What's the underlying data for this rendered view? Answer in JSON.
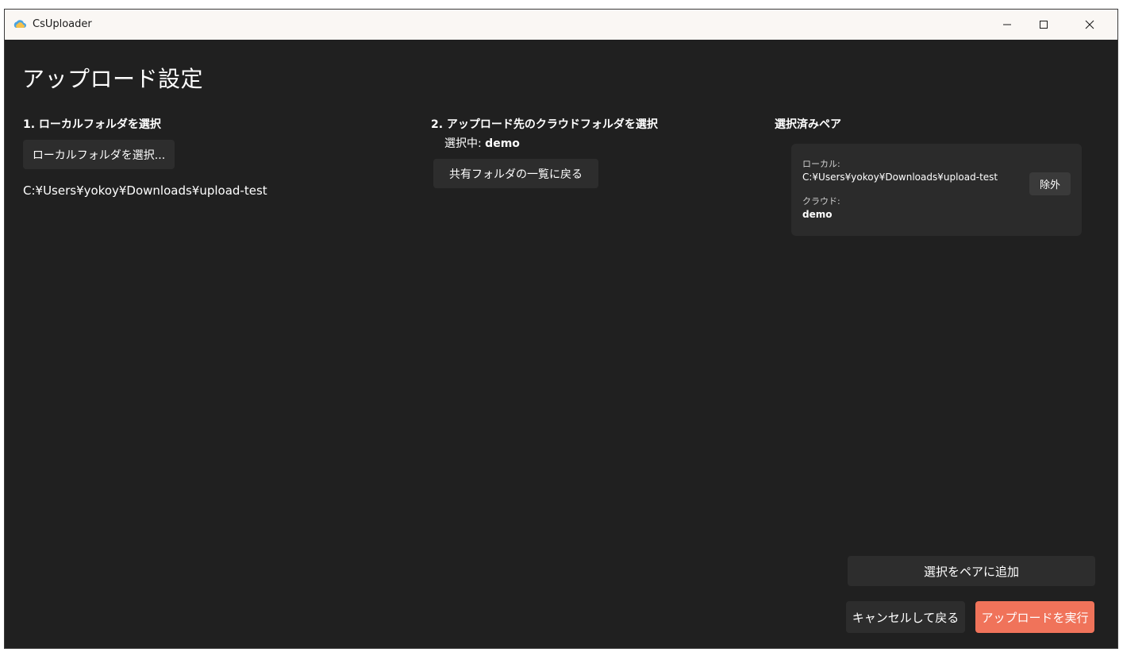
{
  "window": {
    "title": "CsUploader",
    "app_icon": "cloud-icon",
    "controls": [
      "minimize-icon",
      "maximize-icon",
      "close-icon"
    ]
  },
  "page": {
    "title": "アップロード設定"
  },
  "local": {
    "heading": "1. ローカルフォルダを選択",
    "select_button": "ローカルフォルダを選択...",
    "path": "C:¥Users¥yokoy¥Downloads¥upload-test"
  },
  "cloud": {
    "heading": "2. アップロード先のクラウドフォルダを選択",
    "selected_label": "選択中: ",
    "selected_value": "demo",
    "back_button": "共有フォルダの一覧に戻る"
  },
  "pairs": {
    "heading": "選択済みペア",
    "items": [
      {
        "local_label": "ローカル:",
        "local_value": "C:¥Users¥yokoy¥Downloads¥upload-test",
        "cloud_label": "クラウド:",
        "cloud_value": "demo",
        "exclude_button": "除外"
      }
    ]
  },
  "footer": {
    "add_pair_button": "選択をペアに追加",
    "cancel_button": "キャンセルして戻る",
    "run_button": "アップロードを実行"
  },
  "colors": {
    "background": "#202020",
    "titlebar": "#faf7f4",
    "button": "#2d2d2d",
    "accent": "#f0735a"
  }
}
